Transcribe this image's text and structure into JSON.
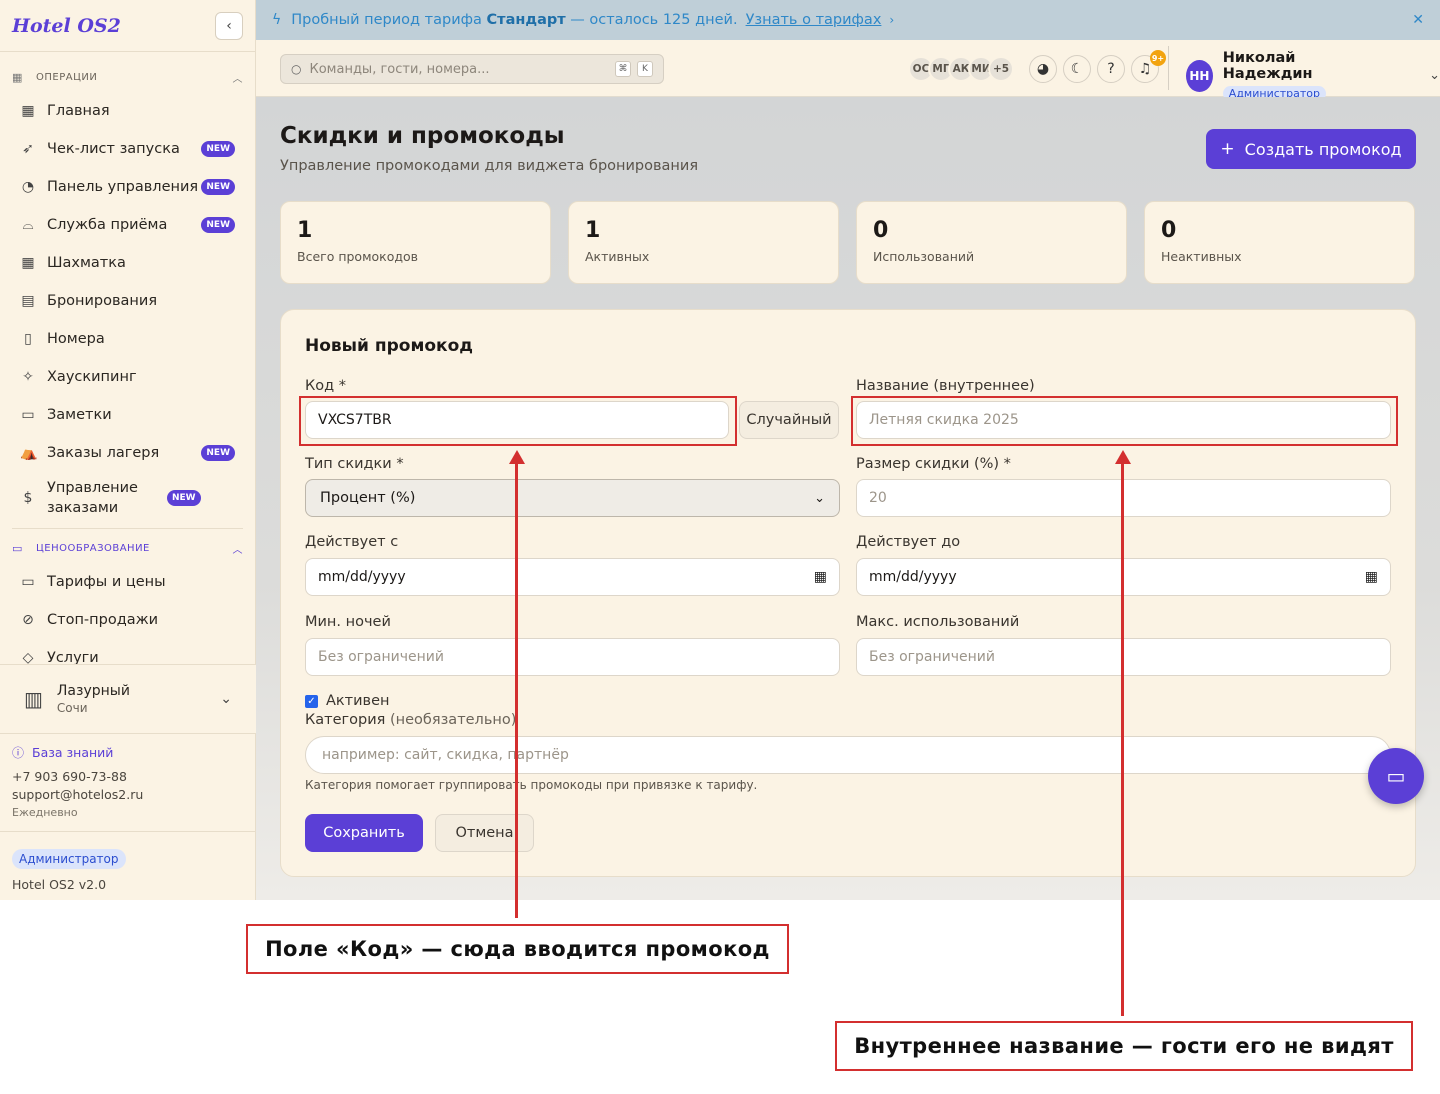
{
  "app": {
    "logo": "Hotel OS2"
  },
  "sidebar": {
    "collapse_icon": "chevron-left-icon",
    "section_ops": "ОПЕРАЦИИ",
    "items_ops": [
      {
        "label": "Главная",
        "icon": "dashboard-icon",
        "badge": ""
      },
      {
        "label": "Чек-лист запуска",
        "icon": "rocket-icon",
        "badge": "NEW"
      },
      {
        "label": "Панель управления",
        "icon": "gauge-icon",
        "badge": "NEW"
      },
      {
        "label": "Служба приёма",
        "icon": "bell-desk-icon",
        "badge": "NEW"
      },
      {
        "label": "Шахматка",
        "icon": "grid-icon",
        "badge": ""
      },
      {
        "label": "Бронирования",
        "icon": "clipboard-icon",
        "badge": ""
      },
      {
        "label": "Номера",
        "icon": "door-icon",
        "badge": ""
      },
      {
        "label": "Хаускипинг",
        "icon": "sparkles-icon",
        "badge": ""
      },
      {
        "label": "Заметки",
        "icon": "note-icon",
        "badge": ""
      },
      {
        "label": "Заказы лагеря",
        "icon": "tent-icon",
        "badge": "NEW"
      },
      {
        "label": "Управление заказами",
        "icon": "dollar-icon",
        "badge": "NEW"
      }
    ],
    "section_pricing": "ЦЕНООБРАЗОВАНИЕ",
    "items_pricing": [
      {
        "label": "Тарифы и цены",
        "icon": "card-icon"
      },
      {
        "label": "Стоп-продажи",
        "icon": "ban-icon"
      },
      {
        "label": "Услуги",
        "icon": "tag-icon"
      }
    ],
    "hotel": {
      "name": "Лазурный",
      "city": "Сочи"
    },
    "help": {
      "kb": "База знаний",
      "phone": "+7 903 690-73-88",
      "email": "support@hotelos2.ru",
      "hours": "Ежедневно"
    },
    "role": "Администратор",
    "version": "Hotel OS2 v2.0"
  },
  "banner": {
    "text_pre": "Пробный период тарифа",
    "plan": "Стандарт",
    "text_post": "— осталось 125 дней.",
    "link": "Узнать о тарифах"
  },
  "topbar": {
    "search_placeholder": "Команды, гости, номера...",
    "kbd1": "⌘",
    "kbd2": "K",
    "avatars": [
      "ОС",
      "МГ",
      "АК",
      "МИ",
      "+5"
    ],
    "notif_count": "9+",
    "user_initials": "НН",
    "user_name": "Николай Надеждин",
    "user_role": "Администратор"
  },
  "page": {
    "title": "Скидки и промокоды",
    "subtitle": "Управление промокодами для виджета бронирования",
    "create_label": "Создать промокод"
  },
  "stats": [
    {
      "value": "1",
      "label": "Всего промокодов"
    },
    {
      "value": "1",
      "label": "Активных"
    },
    {
      "value": "0",
      "label": "Использований"
    },
    {
      "value": "0",
      "label": "Неактивных"
    }
  ],
  "form": {
    "title": "Новый промокод",
    "code_label": "Код *",
    "code_value": "VXCS7TBR",
    "random_label": "Случайный",
    "name_label": "Название (внутреннее)",
    "name_placeholder": "Летняя скидка 2025",
    "type_label": "Тип скидки *",
    "type_value": "Процент (%)",
    "size_label": "Размер скидки (%) *",
    "size_placeholder": "20",
    "from_label": "Действует с",
    "from_placeholder": "mm/dd/yyyy",
    "to_label": "Действует до",
    "to_placeholder": "mm/dd/yyyy",
    "min_label": "Мин. ночей",
    "min_placeholder": "Без ограничений",
    "max_label": "Макс. использований",
    "max_placeholder": "Без ограничений",
    "active_label": "Активен",
    "active_checked": true,
    "category_label": "Категория",
    "category_optional": "(необязательно)",
    "category_placeholder": "например: сайт, скидка, партнёр",
    "category_hint": "Категория помогает группировать промокоды при привязке к тарифу.",
    "save_label": "Сохранить",
    "cancel_label": "Отмена"
  },
  "annotations": {
    "code_callout": "Поле «Код» — сюда вводится промокод",
    "name_callout": "Внутреннее название — гости его не видят",
    "color": "#d32f2f"
  }
}
